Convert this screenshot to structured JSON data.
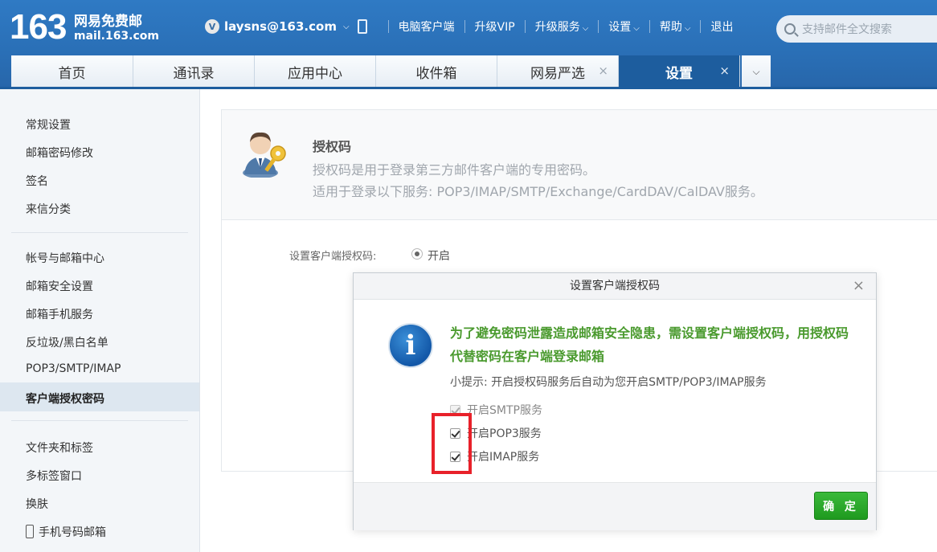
{
  "logo": {
    "number": "163",
    "name": "网易免费邮",
    "url": "mail.163.com"
  },
  "user": {
    "badge": "V",
    "email": "laysns@163.com"
  },
  "userbar": {
    "client": "电脑客户端",
    "vip": "升级VIP",
    "upgrade": "升级服务",
    "settings": "设置",
    "help": "帮助",
    "logout": "退出"
  },
  "search": {
    "placeholder": "支持邮件全文搜索"
  },
  "tabs": [
    {
      "label": "首页"
    },
    {
      "label": "通讯录"
    },
    {
      "label": "应用中心"
    },
    {
      "label": "收件箱"
    },
    {
      "label": "网易严选",
      "close": "×"
    },
    {
      "label": "设置",
      "close": "×"
    }
  ],
  "sidebar": {
    "group1": [
      "常规设置",
      "邮箱密码修改",
      "签名",
      "来信分类"
    ],
    "group2": [
      "帐号与邮箱中心",
      "邮箱安全设置",
      "邮箱手机服务",
      "反垃圾/黑白名单",
      "POP3/SMTP/IMAP",
      "客户端授权密码"
    ],
    "group3": [
      "文件夹和标签",
      "多标签窗口",
      "换肤",
      "手机号码邮箱"
    ],
    "active": "客户端授权密码"
  },
  "panel": {
    "title": "授权码",
    "desc1": "授权码是用于登录第三方邮件客户端的专用密码。",
    "desc2": "适用于登录以下服务: POP3/IMAP/SMTP/Exchange/CardDAV/CalDAV服务。",
    "setting_label": "设置客户端授权码:",
    "option_on": "开启"
  },
  "dialog": {
    "title": "设置客户端授权码",
    "close": "×",
    "warning": "为了避免密码泄露造成邮箱安全隐患，需设置客户端授权码，用授权码代替密码在客户端登录邮箱",
    "tip": "小提示: 开启授权码服务后自动为您开启SMTP/POP3/IMAP服务",
    "options": [
      {
        "label": "开启SMTP服务",
        "checked": true,
        "disabled": true
      },
      {
        "label": "开启POP3服务",
        "checked": true,
        "disabled": false
      },
      {
        "label": "开启IMAP服务",
        "checked": true,
        "disabled": false
      }
    ],
    "ok": "确 定",
    "highlight_color": "#e8212a"
  },
  "colors": {
    "brand": "#2a6fb6",
    "active_tab": "#1d5d9e",
    "ok_green": "#2aa82a",
    "warn_green": "#4a9a2e"
  }
}
